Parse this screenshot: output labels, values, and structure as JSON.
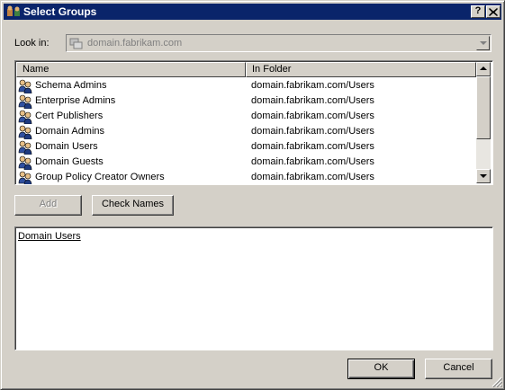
{
  "window": {
    "title": "Select Groups",
    "help_label": "?",
    "close_label": "×"
  },
  "lookin": {
    "label": "Look in:",
    "value": "domain.fabrikam.com"
  },
  "list": {
    "columns": [
      "Name",
      "In Folder"
    ],
    "rows": [
      {
        "name": "Schema Admins",
        "folder": "domain.fabrikam.com/Users"
      },
      {
        "name": "Enterprise Admins",
        "folder": "domain.fabrikam.com/Users"
      },
      {
        "name": "Cert Publishers",
        "folder": "domain.fabrikam.com/Users"
      },
      {
        "name": "Domain Admins",
        "folder": "domain.fabrikam.com/Users"
      },
      {
        "name": "Domain Users",
        "folder": "domain.fabrikam.com/Users"
      },
      {
        "name": "Domain Guests",
        "folder": "domain.fabrikam.com/Users"
      },
      {
        "name": "Group Policy Creator Owners",
        "folder": "domain.fabrikam.com/Users"
      }
    ]
  },
  "buttons": {
    "add": "Add",
    "check_names": "Check Names",
    "ok": "OK",
    "cancel": "Cancel"
  },
  "selected": {
    "entry": "Domain Users"
  },
  "colors": {
    "titlebar": "#0a246a",
    "face": "#d4d0c8",
    "disabled_text": "#808080"
  }
}
